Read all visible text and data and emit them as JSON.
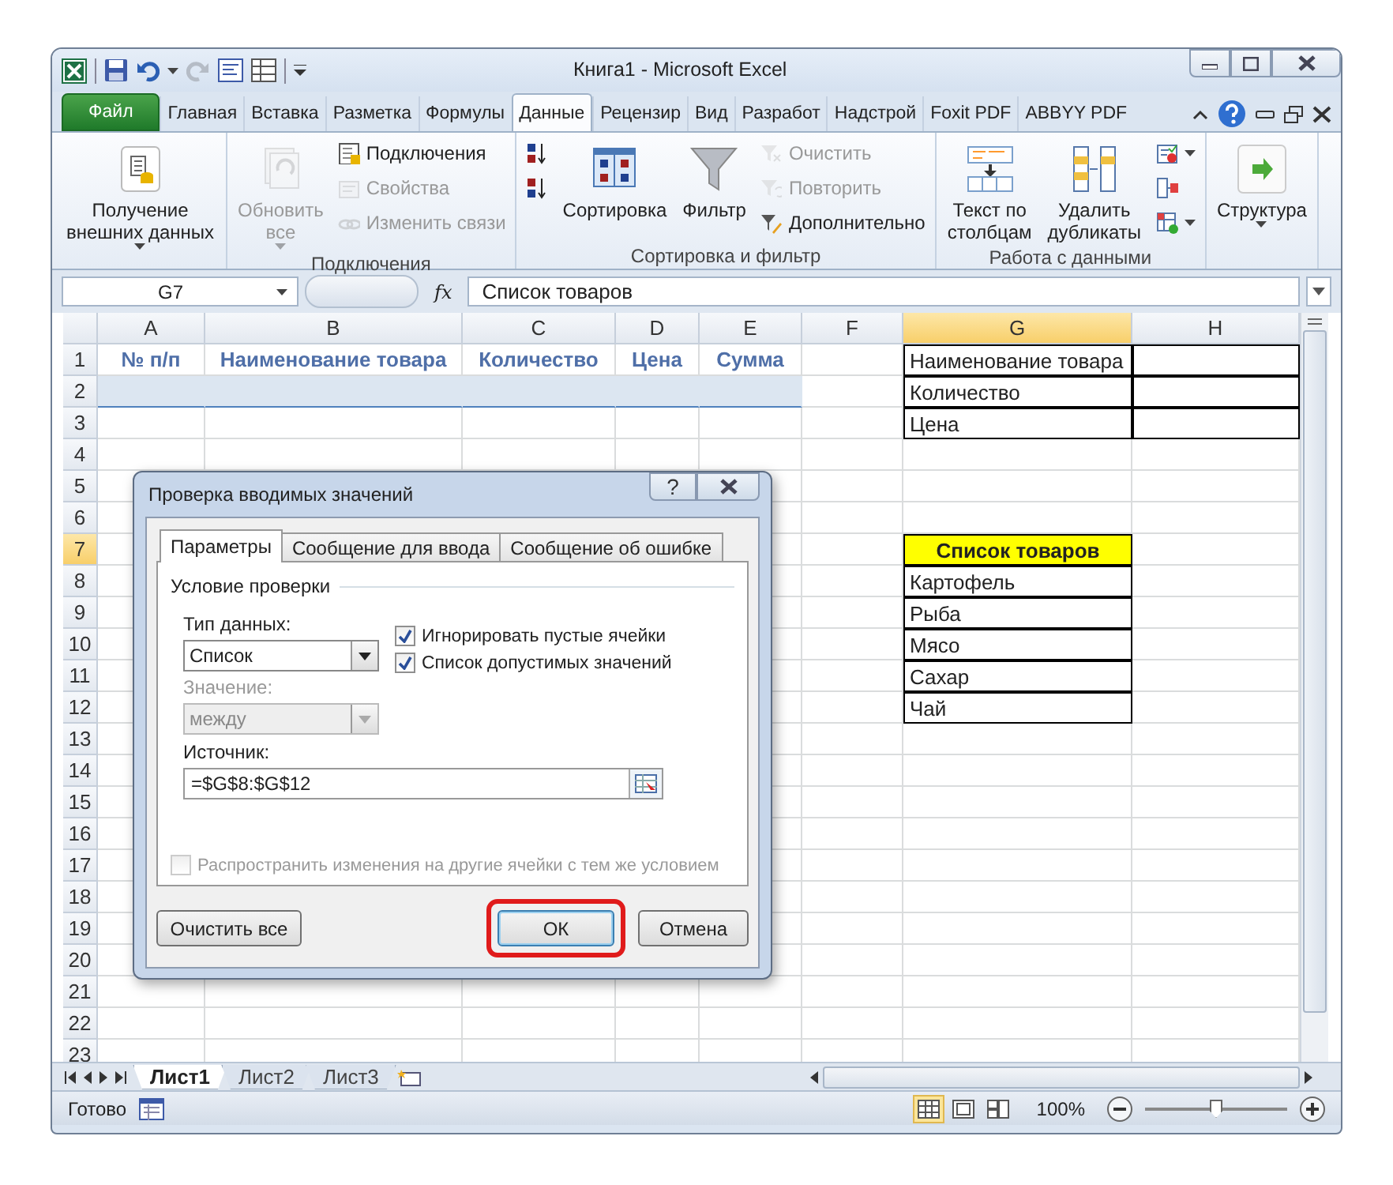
{
  "window": {
    "title": "Книга1  -  Microsoft Excel"
  },
  "tabs": [
    {
      "label": "Файл",
      "kind": "file",
      "selected": false
    },
    {
      "label": "Главная",
      "kind": "tab",
      "selected": false
    },
    {
      "label": "Вставка",
      "kind": "tab",
      "selected": false
    },
    {
      "label": "Разметка",
      "kind": "tab",
      "selected": false
    },
    {
      "label": "Формулы",
      "kind": "tab",
      "selected": false
    },
    {
      "label": "Данные",
      "kind": "tab",
      "selected": true
    },
    {
      "label": "Рецензир",
      "kind": "tab",
      "selected": false
    },
    {
      "label": "Вид",
      "kind": "tab",
      "selected": false
    },
    {
      "label": "Разработ",
      "kind": "tab",
      "selected": false
    },
    {
      "label": "Надстрой",
      "kind": "tab",
      "selected": false
    },
    {
      "label": "Foxit PDF",
      "kind": "tab",
      "selected": false
    },
    {
      "label": "ABBYY PDF",
      "kind": "tab",
      "selected": false
    }
  ],
  "ribbon": {
    "groups": [
      {
        "items": [
          {
            "kind": "large",
            "label": "Получение\nвнешних данных",
            "dropdown": true,
            "disabled": false
          }
        ]
      },
      {
        "label": "Подключения",
        "items": [
          {
            "kind": "large",
            "label": "Обновить\nвсе",
            "dropdown": true,
            "disabled": true
          },
          {
            "kind": "stack",
            "items": [
              {
                "label": "Подключения",
                "dropdown": false,
                "disabled": false
              },
              {
                "label": "Свойства",
                "dropdown": false,
                "disabled": true
              },
              {
                "label": "Изменить связи",
                "dropdown": false,
                "disabled": true
              }
            ]
          }
        ]
      },
      {
        "label": "Сортировка и фильтр",
        "items": [
          {
            "kind": "stack",
            "items": [
              {
                "dropdown": false,
                "disabled": false
              },
              {
                "dropdown": false,
                "disabled": false
              }
            ]
          },
          {
            "kind": "large",
            "label": "Сортировка",
            "dropdown": false,
            "disabled": false
          },
          {
            "kind": "large",
            "label": "Фильтр",
            "dropdown": false,
            "disabled": false
          },
          {
            "kind": "stack",
            "items": [
              {
                "label": "Очистить",
                "dropdown": false,
                "disabled": true
              },
              {
                "label": "Повторить",
                "dropdown": false,
                "disabled": true
              },
              {
                "label": "Дополнительно",
                "dropdown": false,
                "disabled": false
              }
            ]
          }
        ]
      },
      {
        "label": "Работа с данными",
        "items": [
          {
            "kind": "large",
            "label": "Текст по\nстолбцам",
            "dropdown": false,
            "disabled": false
          },
          {
            "kind": "large",
            "label": "Удалить\nдубликаты",
            "dropdown": false,
            "disabled": false
          },
          {
            "kind": "stack",
            "items": [
              {
                "dropdown": true,
                "disabled": false
              },
              {
                "dropdown": false,
                "disabled": false
              },
              {
                "dropdown": true,
                "disabled": false
              }
            ]
          }
        ]
      },
      {
        "items": [
          {
            "kind": "large",
            "label": "Структура",
            "dropdown": true,
            "disabled": false
          }
        ]
      }
    ]
  },
  "formula_bar": {
    "name_box": "G7",
    "fx": "fx",
    "formula": "Список товаров"
  },
  "grid": {
    "columns": [
      {
        "label": "A",
        "selected": false
      },
      {
        "label": "B",
        "selected": false
      },
      {
        "label": "C",
        "selected": false
      },
      {
        "label": "D",
        "selected": false
      },
      {
        "label": "E",
        "selected": false
      },
      {
        "label": "F",
        "selected": false
      },
      {
        "label": "G",
        "selected": true
      },
      {
        "label": "H",
        "selected": false
      }
    ],
    "rows": [
      {
        "number": "1",
        "selected": false,
        "highlighted": false,
        "A": {
          "text": "№ п/п",
          "kind": "header"
        },
        "B": {
          "text": "Наименование товара",
          "kind": "header"
        },
        "C": {
          "text": "Количество",
          "kind": "header"
        },
        "D": {
          "text": "Цена",
          "kind": "header"
        },
        "E": {
          "text": "Сумма",
          "kind": "header"
        },
        "G": {
          "text": "Наименование товара",
          "kind": "boxed"
        },
        "H": {
          "kind": "boxed"
        }
      },
      {
        "number": "2",
        "selected": false,
        "highlighted": true,
        "G": {
          "text": "Количество",
          "kind": "boxed"
        },
        "H": {
          "kind": "boxed"
        }
      },
      {
        "number": "3",
        "selected": false,
        "highlighted": false,
        "G": {
          "text": "Цена",
          "kind": "boxed"
        },
        "H": {
          "kind": "boxed"
        }
      },
      {
        "number": "4",
        "selected": false,
        "highlighted": false
      },
      {
        "number": "5",
        "selected": false,
        "highlighted": false
      },
      {
        "number": "6",
        "selected": false,
        "highlighted": false
      },
      {
        "number": "7",
        "selected": true,
        "highlighted": false,
        "G": {
          "text": "Список товаров",
          "kind": "title"
        }
      },
      {
        "number": "8",
        "selected": false,
        "highlighted": false,
        "G": {
          "text": "Картофель",
          "kind": "boxed"
        }
      },
      {
        "number": "9",
        "selected": false,
        "highlighted": false,
        "G": {
          "text": "Рыба",
          "kind": "boxed"
        }
      },
      {
        "number": "10",
        "selected": false,
        "highlighted": false,
        "G": {
          "text": "Мясо",
          "kind": "boxed"
        }
      },
      {
        "number": "11",
        "selected": false,
        "highlighted": false,
        "G": {
          "text": "Сахар",
          "kind": "boxed"
        }
      },
      {
        "number": "12",
        "selected": false,
        "highlighted": false,
        "G": {
          "text": "Чай",
          "kind": "boxed"
        }
      },
      {
        "number": "13",
        "selected": false,
        "highlighted": false
      },
      {
        "number": "14",
        "selected": false,
        "highlighted": false
      },
      {
        "number": "15",
        "selected": false,
        "highlighted": false
      },
      {
        "number": "16",
        "selected": false,
        "highlighted": false
      },
      {
        "number": "17",
        "selected": false,
        "highlighted": false
      },
      {
        "number": "18",
        "selected": false,
        "highlighted": false
      },
      {
        "number": "19",
        "selected": false,
        "highlighted": false
      },
      {
        "number": "20",
        "selected": false,
        "highlighted": false
      },
      {
        "number": "21",
        "selected": false,
        "highlighted": false
      },
      {
        "number": "22",
        "selected": false,
        "highlighted": false
      },
      {
        "number": "23",
        "selected": false,
        "highlighted": false
      }
    ]
  },
  "sheet_tabs": [
    {
      "label": "Лист1",
      "selected": true
    },
    {
      "label": "Лист2",
      "selected": false
    },
    {
      "label": "Лист3",
      "selected": false
    }
  ],
  "status_bar": {
    "status": "Готово",
    "views": [
      {
        "kind": "normal",
        "selected": true
      },
      {
        "kind": "layout",
        "selected": false
      },
      {
        "kind": "pagebreak",
        "selected": false
      }
    ],
    "zoom": "100%",
    "zoom_slider": {
      "level": 0.5
    }
  },
  "dialog": {
    "title": "Проверка вводимых значений",
    "help": "?",
    "tabs": [
      {
        "label": "Параметры",
        "selected": true
      },
      {
        "label": "Сообщение для ввода",
        "selected": false
      },
      {
        "label": "Сообщение об ошибке",
        "selected": false
      }
    ],
    "section": "Условие проверки",
    "type_label": "Тип данных:",
    "type_value": "Список",
    "value_label": "Значение:",
    "value_value": "между",
    "value_disabled": true,
    "checkboxes": [
      {
        "label": "Игнорировать пустые ячейки",
        "checked": true,
        "disabled": false
      },
      {
        "label": "Список допустимых значений",
        "checked": true,
        "disabled": false
      },
      {
        "label": "Распространить изменения на другие ячейки с тем же условием",
        "checked": false,
        "disabled": true
      }
    ],
    "source_label": "Источник:",
    "source_value": "=$G$8:$G$12",
    "buttons": [
      {
        "label": "Очистить все",
        "kind": "left",
        "highlighted": false
      },
      {
        "label": "ОК",
        "kind": "default",
        "highlighted": true
      },
      {
        "label": "Отмена",
        "kind": "normal",
        "highlighted": false
      }
    ]
  }
}
